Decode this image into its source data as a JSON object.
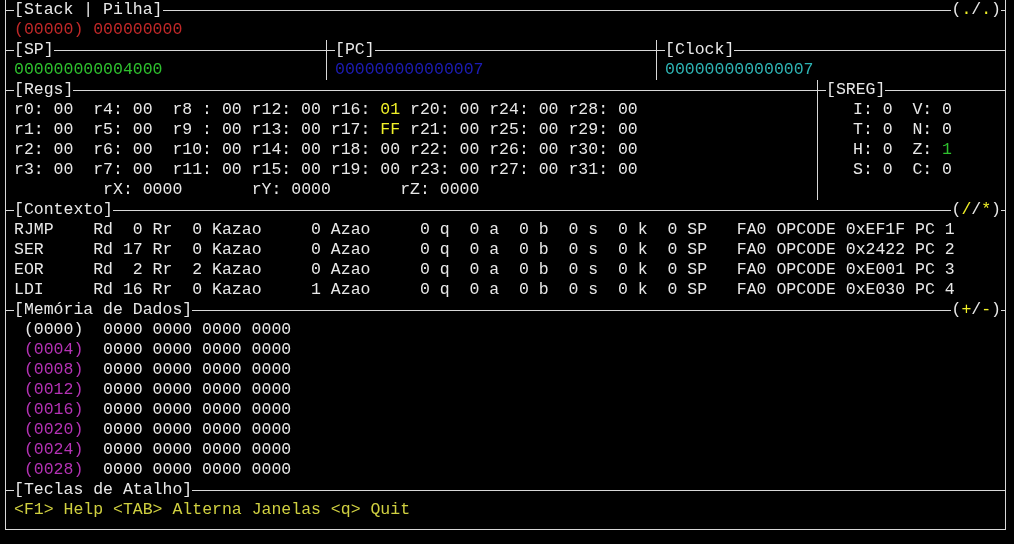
{
  "stack": {
    "title": "[Stack | Pilha]",
    "indicator": "(./.)",
    "entry": "(00000) 000000000"
  },
  "counters": [
    {
      "title": "[SP]",
      "value": "000000000004000",
      "kind": "sp"
    },
    {
      "title": "[PC]",
      "value": "000000000000007",
      "kind": "pc"
    },
    {
      "title": "[Clock]",
      "value": "000000000000007",
      "kind": "clock"
    }
  ],
  "regs": {
    "title": "[Regs]",
    "registers": [
      {
        "label": "r0:",
        "value": "00",
        "changed": false
      },
      {
        "label": "r1:",
        "value": "00",
        "changed": false
      },
      {
        "label": "r2:",
        "value": "00",
        "changed": false
      },
      {
        "label": "r3:",
        "value": "00",
        "changed": false
      },
      {
        "label": "r4:",
        "value": "00",
        "changed": false
      },
      {
        "label": "r5:",
        "value": "00",
        "changed": false
      },
      {
        "label": "r6:",
        "value": "00",
        "changed": false
      },
      {
        "label": "r7:",
        "value": "00",
        "changed": false
      },
      {
        "label": "r8 :",
        "value": "00",
        "changed": false
      },
      {
        "label": "r9 :",
        "value": "00",
        "changed": false
      },
      {
        "label": "r10:",
        "value": "00",
        "changed": false
      },
      {
        "label": "r11:",
        "value": "00",
        "changed": false
      },
      {
        "label": "r12:",
        "value": "00",
        "changed": false
      },
      {
        "label": "r13:",
        "value": "00",
        "changed": false
      },
      {
        "label": "r14:",
        "value": "00",
        "changed": false
      },
      {
        "label": "r15:",
        "value": "00",
        "changed": false
      },
      {
        "label": "r16:",
        "value": "01",
        "changed": true
      },
      {
        "label": "r17:",
        "value": "FF",
        "changed": true
      },
      {
        "label": "r18:",
        "value": "00",
        "changed": false
      },
      {
        "label": "r19:",
        "value": "00",
        "changed": false
      },
      {
        "label": "r20:",
        "value": "00",
        "changed": false
      },
      {
        "label": "r21:",
        "value": "00",
        "changed": false
      },
      {
        "label": "r22:",
        "value": "00",
        "changed": false
      },
      {
        "label": "r23:",
        "value": "00",
        "changed": false
      },
      {
        "label": "r24:",
        "value": "00",
        "changed": false
      },
      {
        "label": "r25:",
        "value": "00",
        "changed": false
      },
      {
        "label": "r26:",
        "value": "00",
        "changed": false
      },
      {
        "label": "r27:",
        "value": "00",
        "changed": false
      },
      {
        "label": "r28:",
        "value": "00",
        "changed": false
      },
      {
        "label": "r29:",
        "value": "00",
        "changed": false
      },
      {
        "label": "r30:",
        "value": "00",
        "changed": false
      },
      {
        "label": "r31:",
        "value": "00",
        "changed": false
      }
    ],
    "pointers": [
      {
        "label": "rX:",
        "value": "0000"
      },
      {
        "label": "rY:",
        "value": "0000"
      },
      {
        "label": "rZ:",
        "value": "0000"
      }
    ]
  },
  "sreg": {
    "title": "[SREG]",
    "flags": [
      {
        "label": "I:",
        "value": "0",
        "set": false
      },
      {
        "label": "V:",
        "value": "0",
        "set": false
      },
      {
        "label": "T:",
        "value": "0",
        "set": false
      },
      {
        "label": "N:",
        "value": "0",
        "set": false
      },
      {
        "label": "H:",
        "value": "0",
        "set": false
      },
      {
        "label": "Z:",
        "value": "1",
        "set": true
      },
      {
        "label": "S:",
        "value": "0",
        "set": false
      },
      {
        "label": "C:",
        "value": "0",
        "set": false
      }
    ]
  },
  "context": {
    "title": "[Contexto]",
    "indicator": "(//*)",
    "rows": [
      "RJMP    Rd  0 Rr  0 Kazao     0 Azao     0 q  0 a  0 b  0 s  0 k  0 SP   FA0 OPCODE 0xEF1F PC 1",
      "SER     Rd 17 Rr  0 Kazao     0 Azao     0 q  0 a  0 b  0 s  0 k  0 SP   FA0 OPCODE 0x2422 PC 2",
      "EOR     Rd  2 Rr  2 Kazao     0 Azao     0 q  0 a  0 b  0 s  0 k  0 SP   FA0 OPCODE 0xE001 PC 3",
      "LDI     Rd 16 Rr  0 Kazao     1 Azao     0 q  0 a  0 b  0 s  0 k  0 SP   FA0 OPCODE 0xE030 PC 4"
    ]
  },
  "memory": {
    "title": "[Memória de Dados]",
    "indicator": "(+/-)",
    "rows": [
      {
        "address": "(0000)",
        "words": [
          "0000",
          "0000",
          "0000",
          "0000"
        ],
        "selected": true
      },
      {
        "address": "(0004)",
        "words": [
          "0000",
          "0000",
          "0000",
          "0000"
        ],
        "selected": false
      },
      {
        "address": "(0008)",
        "words": [
          "0000",
          "0000",
          "0000",
          "0000"
        ],
        "selected": false
      },
      {
        "address": "(0012)",
        "words": [
          "0000",
          "0000",
          "0000",
          "0000"
        ],
        "selected": false
      },
      {
        "address": "(0016)",
        "words": [
          "0000",
          "0000",
          "0000",
          "0000"
        ],
        "selected": false
      },
      {
        "address": "(0020)",
        "words": [
          "0000",
          "0000",
          "0000",
          "0000"
        ],
        "selected": false
      },
      {
        "address": "(0024)",
        "words": [
          "0000",
          "0000",
          "0000",
          "0000"
        ],
        "selected": false
      },
      {
        "address": "(0028)",
        "words": [
          "0000",
          "0000",
          "0000",
          "0000"
        ],
        "selected": false
      }
    ]
  },
  "shortcuts": {
    "title": "[Teclas de Atalho]",
    "items": [
      {
        "key": "<F1>",
        "action": "Help"
      },
      {
        "key": "<TAB>",
        "action": "Alterna Janelas"
      },
      {
        "key": "<q>",
        "action": "Quit"
      }
    ]
  }
}
